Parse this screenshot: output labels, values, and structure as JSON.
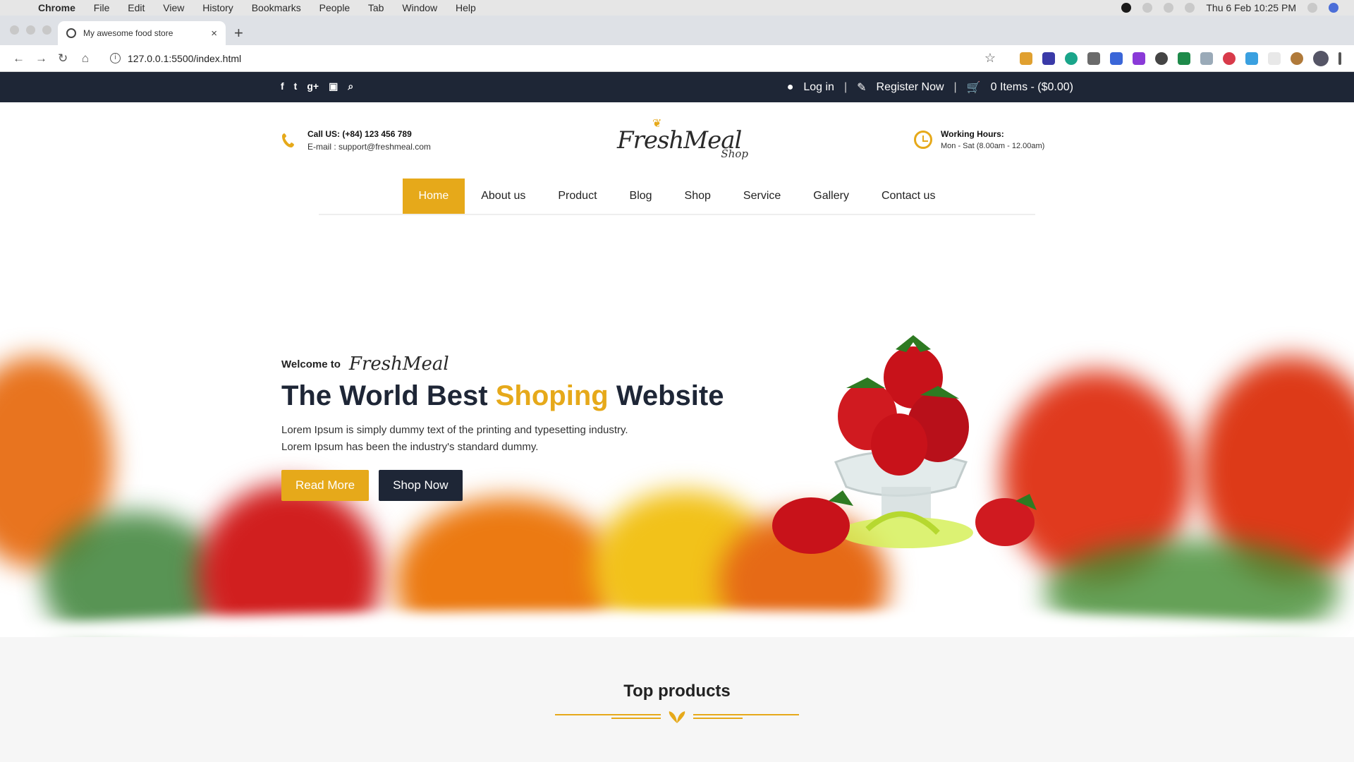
{
  "macos": {
    "apple_glyph": "",
    "menus": [
      "Chrome",
      "File",
      "Edit",
      "View",
      "History",
      "Bookmarks",
      "People",
      "Tab",
      "Window",
      "Help"
    ],
    "clock": "Thu 6 Feb  10:25 PM"
  },
  "browser": {
    "tab_title": "My awesome food store",
    "tab_close": "×",
    "new_tab": "+",
    "url": "127.0.0.1:5500/index.html",
    "info_glyph": "i",
    "back": "←",
    "forward": "→",
    "reload": "↻",
    "home": "⌂",
    "star": "☆"
  },
  "topbar": {
    "social": [
      "f",
      "t",
      "g+",
      "▣",
      "⌕"
    ],
    "login": "Log in",
    "separator": "|",
    "register": "Register Now",
    "cart": "0 Items - ($0.00)"
  },
  "header": {
    "call": "Call US: (+84) 123 456 789",
    "email": "E-mail : support@freshmeal.com",
    "logo_text": "FreshMeal",
    "logo_sub": "Shop",
    "hours_title": "Working Hours:",
    "hours_value": "Mon - Sat (8.00am - 12.00am)"
  },
  "nav": {
    "items": [
      "Home",
      "About us",
      "Product",
      "Blog",
      "Shop",
      "Service",
      "Gallery",
      "Contact us"
    ]
  },
  "hero": {
    "welcome": "Welcome to",
    "welcome_script": "FreshMeal",
    "headline_pre": "The World Best",
    "headline_accent": "Shoping",
    "headline_post": "Website",
    "desc_line1": "Lorem Ipsum is simply dummy text of the printing and typesetting industry.",
    "desc_line2": "Lorem Ipsum has been the industry's standard dummy.",
    "read_more": "Read More",
    "shop_now": "Shop Now"
  },
  "products": {
    "title": "Top products"
  },
  "colors": {
    "accent": "#e6a91a",
    "dark": "#1e2636"
  }
}
